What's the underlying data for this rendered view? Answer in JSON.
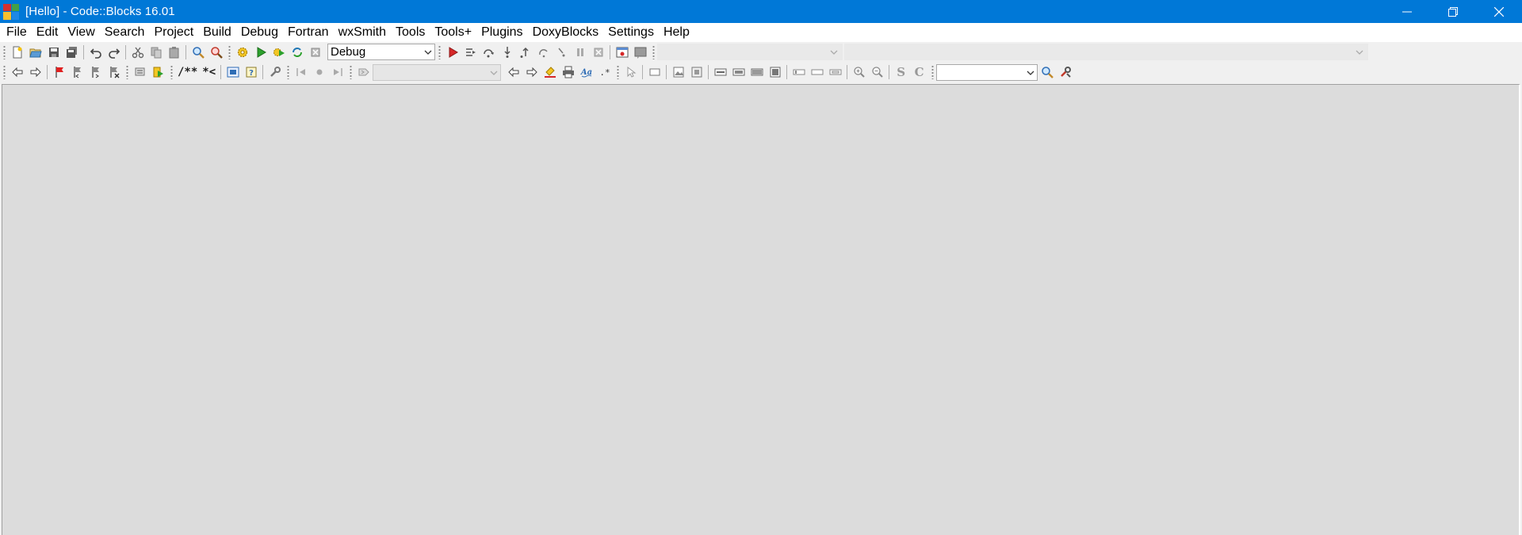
{
  "window": {
    "title": "[Hello] - Code::Blocks 16.01",
    "accent_color": "#0078d7",
    "controls": [
      "minimize-icon",
      "restore-icon",
      "close-icon"
    ]
  },
  "menu": [
    {
      "label": "File"
    },
    {
      "label": "Edit"
    },
    {
      "label": "View"
    },
    {
      "label": "Search"
    },
    {
      "label": "Project"
    },
    {
      "label": "Build"
    },
    {
      "label": "Debug"
    },
    {
      "label": "Fortran"
    },
    {
      "label": "wxSmith"
    },
    {
      "label": "Tools"
    },
    {
      "label": "Tools+"
    },
    {
      "label": "Plugins"
    },
    {
      "label": "DoxyBlocks"
    },
    {
      "label": "Settings"
    },
    {
      "label": "Help"
    }
  ],
  "toolbar": {
    "build_target": "Debug",
    "doxy_comment_block": "/**",
    "doxy_line_comment": "*<",
    "format_style_s": "S",
    "format_style_c": "C",
    "code_completion_scope": "",
    "code_completion_function": "",
    "search_field_value": ""
  },
  "workspace": {
    "background": "#dcdcdc"
  }
}
